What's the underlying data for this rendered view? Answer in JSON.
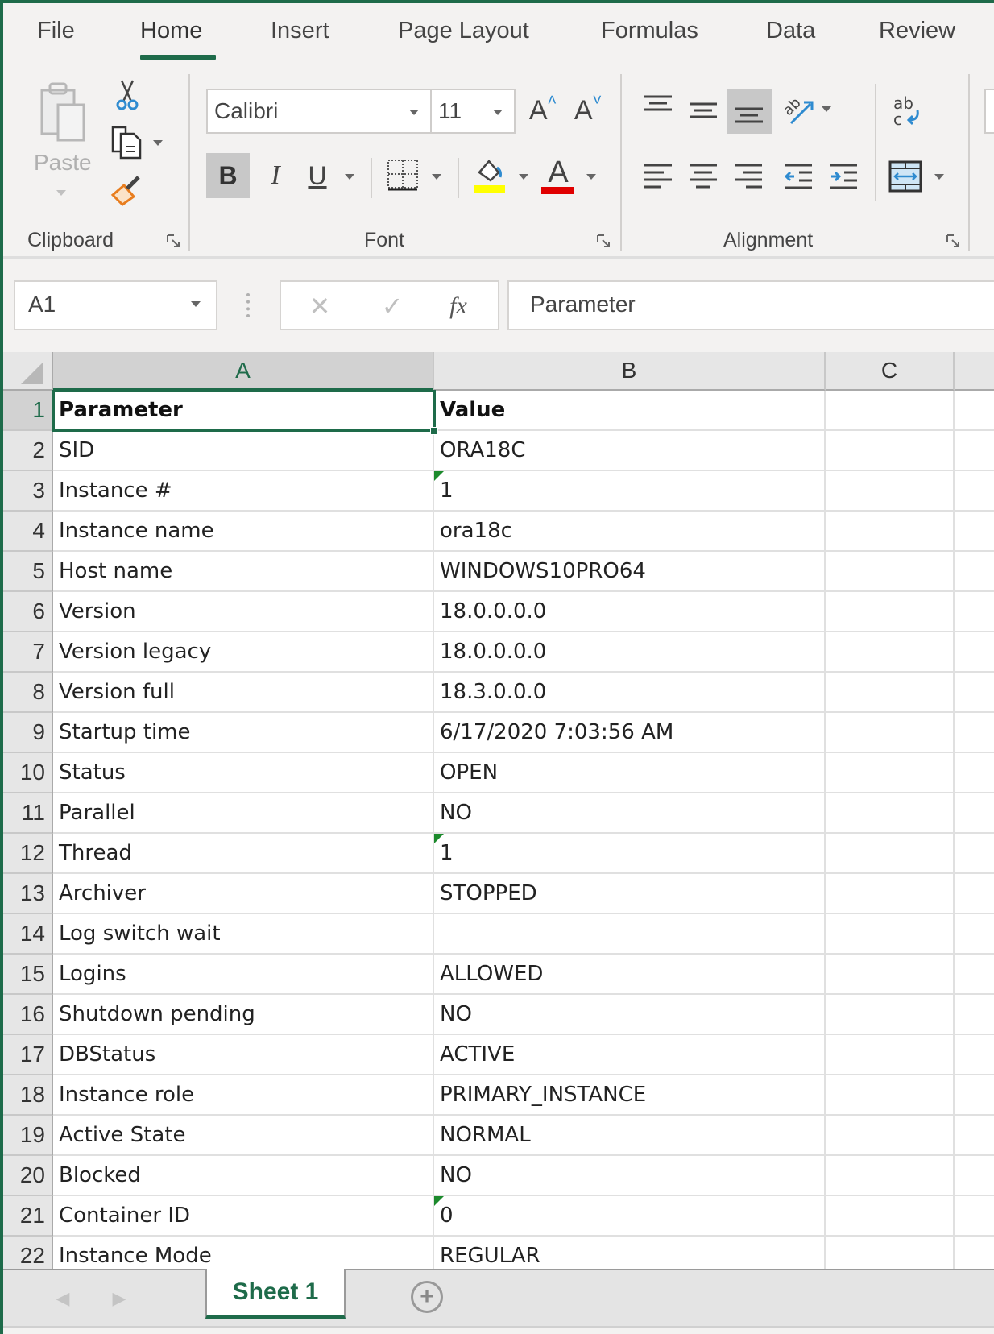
{
  "ribbon_tabs": [
    {
      "label": "File",
      "active": false
    },
    {
      "label": "Home",
      "active": true
    },
    {
      "label": "Insert",
      "active": false
    },
    {
      "label": "Page Layout",
      "active": false
    },
    {
      "label": "Formulas",
      "active": false
    },
    {
      "label": "Data",
      "active": false
    },
    {
      "label": "Review",
      "active": false
    }
  ],
  "clipboard": {
    "group_label": "Clipboard",
    "paste_label": "Paste",
    "icons": [
      "paste-icon",
      "cut-icon",
      "copy-icon",
      "format-painter-icon"
    ]
  },
  "font": {
    "group_label": "Font",
    "font_name": "Calibri",
    "font_size": "11",
    "bold_active": true,
    "bold_label": "B",
    "italic_label": "I",
    "underline_label": "U",
    "increase_font_label": "A",
    "decrease_font_label": "A",
    "font_color_label": "A",
    "fill_color": "#ffff00",
    "font_color": "#e00000"
  },
  "alignment": {
    "group_label": "Alignment",
    "active_vertical_align": "bottom",
    "wrap_text_label": "ab c"
  },
  "formula_bar": {
    "name_box": "A1",
    "fx_label": "fx",
    "content": "Parameter"
  },
  "sheet": {
    "columns": [
      "A",
      "B",
      "C"
    ],
    "selected_cell": "A1",
    "rows": [
      {
        "n": "1",
        "a": "Parameter",
        "b": "Value",
        "bold": true,
        "num_text": false
      },
      {
        "n": "2",
        "a": "SID",
        "b": "ORA18C",
        "num_text": false
      },
      {
        "n": "3",
        "a": "Instance #",
        "b": "1",
        "num_text": true
      },
      {
        "n": "4",
        "a": "Instance name",
        "b": "ora18c",
        "num_text": false
      },
      {
        "n": "5",
        "a": "Host name",
        "b": "WINDOWS10PRO64",
        "num_text": false
      },
      {
        "n": "6",
        "a": "Version",
        "b": "18.0.0.0.0",
        "num_text": false
      },
      {
        "n": "7",
        "a": "Version legacy",
        "b": "18.0.0.0.0",
        "num_text": false
      },
      {
        "n": "8",
        "a": "Version full",
        "b": "18.3.0.0.0",
        "num_text": false
      },
      {
        "n": "9",
        "a": "Startup time",
        "b": "6/17/2020 7:03:56 AM",
        "num_text": false
      },
      {
        "n": "10",
        "a": "Status",
        "b": "OPEN",
        "num_text": false
      },
      {
        "n": "11",
        "a": "Parallel",
        "b": "NO",
        "num_text": false
      },
      {
        "n": "12",
        "a": "Thread",
        "b": "1",
        "num_text": true
      },
      {
        "n": "13",
        "a": "Archiver",
        "b": "STOPPED",
        "num_text": false
      },
      {
        "n": "14",
        "a": "Log switch wait",
        "b": "",
        "num_text": false
      },
      {
        "n": "15",
        "a": "Logins",
        "b": "ALLOWED",
        "num_text": false
      },
      {
        "n": "16",
        "a": "Shutdown pending",
        "b": "NO",
        "num_text": false
      },
      {
        "n": "17",
        "a": "DBStatus",
        "b": "ACTIVE",
        "num_text": false
      },
      {
        "n": "18",
        "a": "Instance role",
        "b": "PRIMARY_INSTANCE",
        "num_text": false
      },
      {
        "n": "19",
        "a": "Active State",
        "b": "NORMAL",
        "num_text": false
      },
      {
        "n": "20",
        "a": "Blocked",
        "b": "NO",
        "num_text": false
      },
      {
        "n": "21",
        "a": "Container ID",
        "b": "0",
        "num_text": true
      },
      {
        "n": "22",
        "a": "Instance Mode",
        "b": "REGULAR",
        "num_text": false
      }
    ]
  },
  "sheet_tabs": [
    {
      "label": "Sheet 1",
      "active": true
    }
  ],
  "colors": {
    "accent": "#1e6b4a",
    "error_indicator": "#1c8a2c"
  }
}
